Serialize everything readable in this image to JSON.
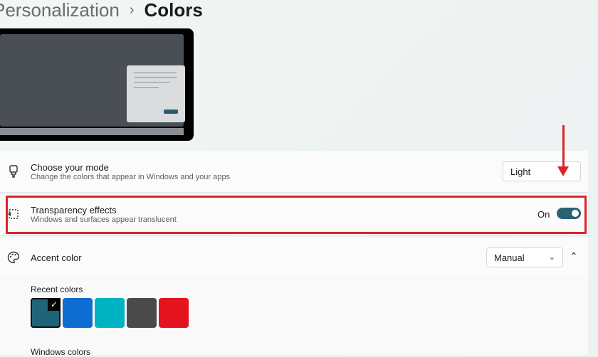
{
  "breadcrumb": {
    "parent": "Personalization",
    "separator": "›",
    "current": "Colors"
  },
  "mode": {
    "title": "Choose your mode",
    "description": "Change the colors that appear in Windows and your apps",
    "selected": "Light",
    "icon": "brush-icon"
  },
  "transparency": {
    "title": "Transparency effects",
    "description": "Windows and surfaces appear translucent",
    "state_label": "On",
    "enabled": true,
    "icon": "transparency-icon"
  },
  "accent": {
    "title": "Accent color",
    "selected": "Manual",
    "icon": "palette-icon",
    "expanded": true,
    "recent_label": "Recent colors",
    "windows_label": "Windows colors",
    "recent_colors": [
      "#1f6478",
      "#0f6cd0",
      "#00b3c3",
      "#4a4a4a",
      "#e3141e"
    ],
    "selected_recent_index": 0
  },
  "annotation_color": "#d7262c"
}
